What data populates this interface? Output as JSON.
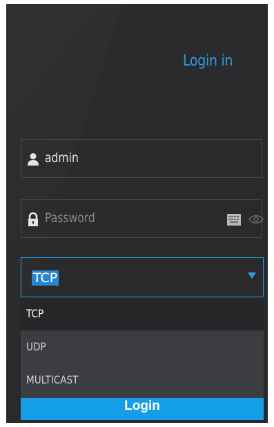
{
  "title": "Login in",
  "username": {
    "value": "admin"
  },
  "password": {
    "placeholder": "Password"
  },
  "protocol": {
    "selected": "TCP",
    "options": [
      "TCP",
      "UDP",
      "MULTICAST"
    ]
  },
  "login_label": "Login",
  "colors": {
    "accent": "#2a9fe6",
    "panel": "#2a2a2d",
    "button": "#159ee8"
  },
  "icons": [
    "user-icon",
    "lock-icon",
    "keyboard-icon",
    "eye-icon",
    "caret-down-icon"
  ]
}
